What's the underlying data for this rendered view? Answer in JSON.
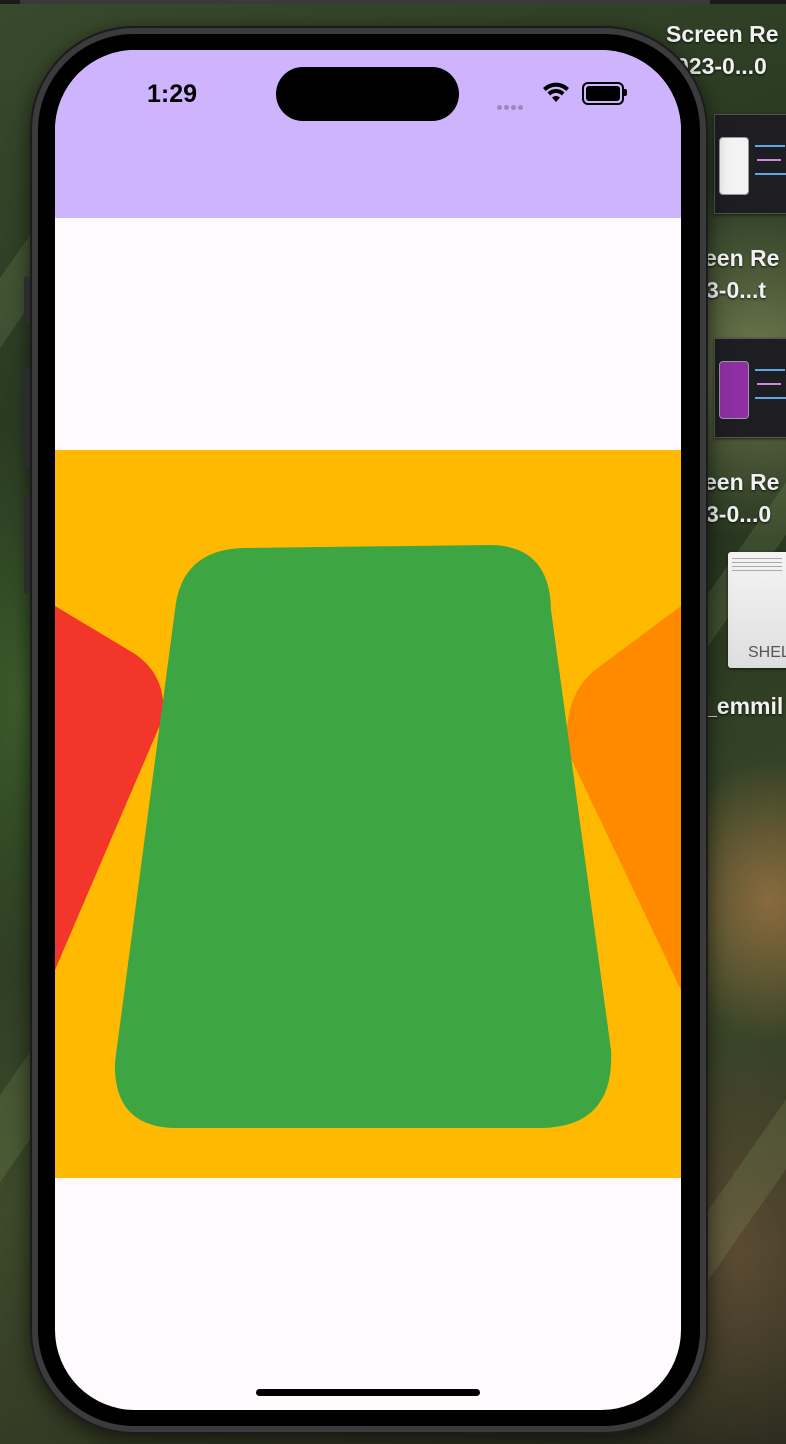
{
  "desktop": {
    "items": [
      {
        "label_line1": "Screen Re",
        "label_line2": "023-0...0"
      },
      {
        "label_line1": "een Re",
        "label_line2": "3-0...t"
      },
      {
        "label_line1": "een Re",
        "label_line2": "3-0...0"
      },
      {
        "label_line1": "_emmil"
      }
    ],
    "doc_thumb_text": "SHEL"
  },
  "status_bar": {
    "time": "1:29"
  },
  "colors": {
    "header": "#cdb4fd",
    "page_background": "#fffafd",
    "carousel_background": "#ffb901",
    "card_center": "#3da642",
    "card_left": "#f2362a",
    "card_right": "#ff8a00"
  },
  "icons": {
    "signal": "signal-dots-icon",
    "wifi": "wifi-icon",
    "battery": "battery-icon"
  }
}
